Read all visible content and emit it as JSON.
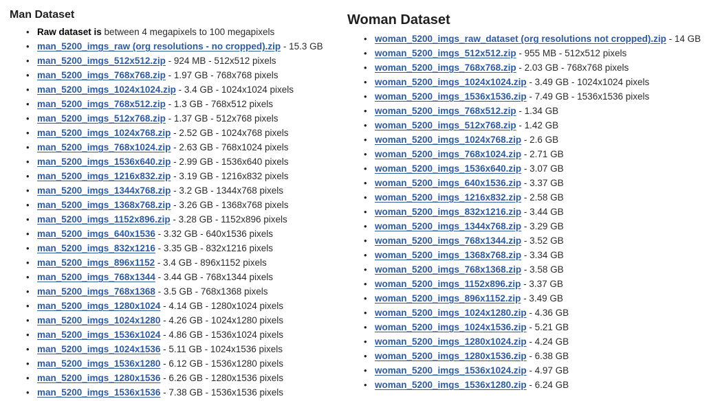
{
  "man": {
    "title": "Man Dataset",
    "intro": {
      "bold": "Raw dataset is",
      "text": " between 4 megapixels to 100 megapixels"
    },
    "files": [
      {
        "name": "man_5200_imgs_raw (org resolutions - no cropped).zip",
        "desc": " - 15.3 GB"
      },
      {
        "name": "man_5200_imgs_512x512.zip",
        "desc": " - 924 MB - 512x512 pixels"
      },
      {
        "name": "man_5200_imgs_768x768.zip",
        "desc": " - 1.97 GB - 768x768 pixels"
      },
      {
        "name": "man_5200_imgs_1024x1024.zip",
        "desc": " - 3.4 GB - 1024x1024 pixels"
      },
      {
        "name": "man_5200_imgs_768x512.zip",
        "desc": " - 1.3 GB - 768x512 pixels"
      },
      {
        "name": "man_5200_imgs_512x768.zip",
        "desc": " - 1.37 GB - 512x768 pixels"
      },
      {
        "name": "man_5200_imgs_1024x768.zip",
        "desc": " - 2.52 GB - 1024x768 pixels"
      },
      {
        "name": "man_5200_imgs_768x1024.zip",
        "desc": " - 2.63 GB - 768x1024 pixels"
      },
      {
        "name": "man_5200_imgs_1536x640.zip",
        "desc": " - 2.99 GB - 1536x640 pixels"
      },
      {
        "name": "man_5200_imgs_1216x832.zip",
        "desc": " - 3.19 GB - 1216x832 pixels"
      },
      {
        "name": "man_5200_imgs_1344x768.zip",
        "desc": " - 3.2 GB - 1344x768 pixels"
      },
      {
        "name": "man_5200_imgs_1368x768.zip",
        "desc": " - 3.26 GB - 1368x768 pixels"
      },
      {
        "name": "man_5200_imgs_1152x896.zip",
        "desc": " - 3.28 GB - 1152x896 pixels"
      },
      {
        "name": "man_5200_imgs_640x1536",
        "desc": " - 3.32 GB - 640x1536 pixels"
      },
      {
        "name": "man_5200_imgs_832x1216",
        "desc": " - 3.35 GB - 832x1216 pixels"
      },
      {
        "name": "man_5200_imgs_896x1152",
        "desc": " - 3.4 GB - 896x1152 pixels"
      },
      {
        "name": "man_5200_imgs_768x1344",
        "desc": " - 3.44 GB - 768x1344 pixels"
      },
      {
        "name": "man_5200_imgs_768x1368",
        "desc": " - 3.5 GB - 768x1368 pixels"
      },
      {
        "name": "man_5200_imgs_1280x1024",
        "desc": " - 4.14 GB - 1280x1024 pixels"
      },
      {
        "name": "man_5200_imgs_1024x1280",
        "desc": " - 4.26 GB - 1024x1280 pixels"
      },
      {
        "name": "man_5200_imgs_1536x1024",
        "desc": " - 4.86 GB - 1536x1024 pixels"
      },
      {
        "name": "man_5200_imgs_1024x1536",
        "desc": " - 5.11 GB - 1024x1536 pixels"
      },
      {
        "name": "man_5200_imgs_1536x1280",
        "desc": " - 6.12 GB - 1536x1280 pixels"
      },
      {
        "name": "man_5200_imgs_1280x1536",
        "desc": " - 6.26 GB - 1280x1536 pixels"
      },
      {
        "name": "man_5200_imgs_1536x1536",
        "desc": " - 7.38 GB - 1536x1536 pixels"
      }
    ]
  },
  "woman": {
    "title": "Woman Dataset",
    "files": [
      {
        "name": "woman_5200_imgs_raw_dataset (org resolutions not cropped).zip",
        "desc": " - 14 GB"
      },
      {
        "name": "woman_5200_imgs_512x512.zip",
        "desc": " - 955 MB - 512x512 pixels"
      },
      {
        "name": "woman_5200_imgs_768x768.zip",
        "desc": " - 2.03 GB - 768x768 pixels"
      },
      {
        "name": "woman_5200_imgs_1024x1024.zip",
        "desc": " - 3.49 GB - 1024x1024 pixels"
      },
      {
        "name": "woman_5200_imgs_1536x1536.zip",
        "desc": " - 7.49 GB - 1536x1536 pixels"
      },
      {
        "name": "woman_5200_imgs_768x512.zip",
        "desc": " - 1.34 GB"
      },
      {
        "name": "woman_5200_imgs_512x768.zip",
        "desc": " - 1.42 GB"
      },
      {
        "name": "woman_5200_imgs_1024x768.zip",
        "desc": " - 2.6 GB"
      },
      {
        "name": "woman_5200_imgs_768x1024.zip",
        "desc": " - 2.71 GB"
      },
      {
        "name": "woman_5200_imgs_1536x640.zip",
        "desc": " - 3.07 GB"
      },
      {
        "name": "woman_5200_imgs_640x1536.zip",
        "desc": " - 3.37 GB"
      },
      {
        "name": "woman_5200_imgs_1216x832.zip",
        "desc": " - 2.58 GB"
      },
      {
        "name": "woman_5200_imgs_832x1216.zip",
        "desc": " - 3.44 GB"
      },
      {
        "name": "woman_5200_imgs_1344x768.zip",
        "desc": " - 3.29 GB"
      },
      {
        "name": "woman_5200_imgs_768x1344.zip",
        "desc": " - 3.52 GB"
      },
      {
        "name": "woman_5200_imgs_1368x768.zip",
        "desc": " - 3.34 GB"
      },
      {
        "name": "woman_5200_imgs_768x1368.zip",
        "desc": " - 3.58 GB"
      },
      {
        "name": "woman_5200_imgs_1152x896.zip",
        "desc": " - 3.37 GB"
      },
      {
        "name": "woman_5200_imgs_896x1152.zip",
        "desc": " - 3.49 GB"
      },
      {
        "name": "woman_5200_imgs_1024x1280.zip",
        "desc": " - 4.36 GB"
      },
      {
        "name": "woman_5200_imgs_1024x1536.zip",
        "desc": " - 5.21 GB"
      },
      {
        "name": "woman_5200_imgs_1280x1024.zip",
        "desc": " - 4.24 GB"
      },
      {
        "name": "woman_5200_imgs_1280x1536.zip",
        "desc": " - 6.38 GB"
      },
      {
        "name": "woman_5200_imgs_1536x1024.zip",
        "desc": " - 4.97 GB"
      },
      {
        "name": "woman_5200_imgs_1536x1280.zip",
        "desc": " - 6.24 GB"
      }
    ]
  },
  "colors": {
    "link": "#2e5a9e",
    "text": "#2a2a2a",
    "background": "#ffffff"
  }
}
